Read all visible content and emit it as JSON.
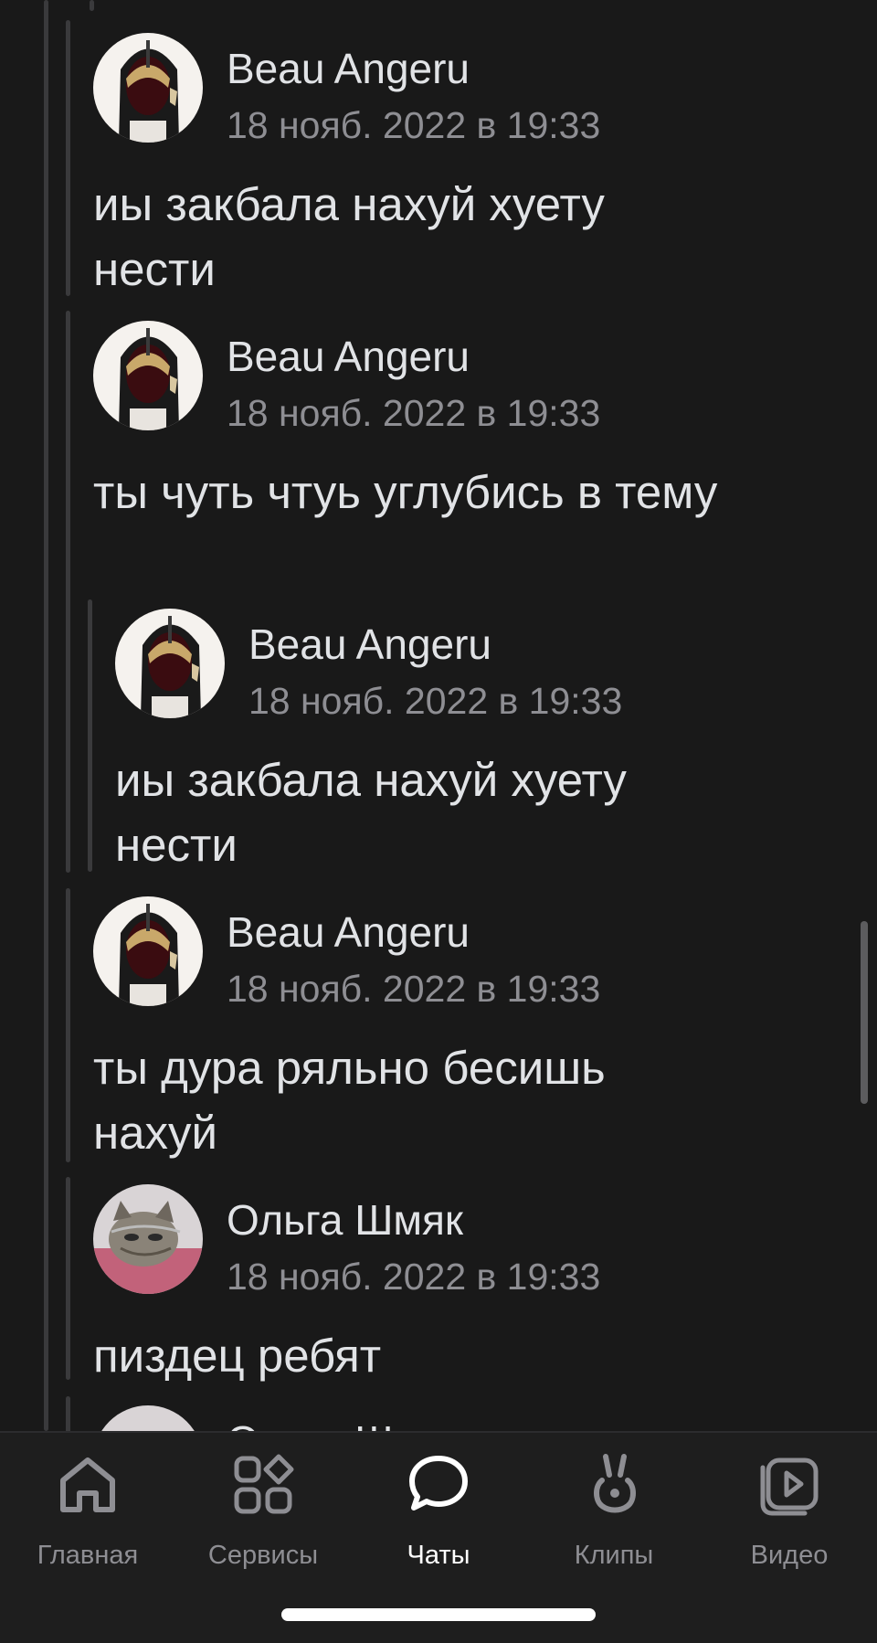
{
  "messages": [
    {
      "author": "Beau Angeru",
      "time": "18 нояб. 2022 в 19:33",
      "text": "иы закбала нахуй хуету нести",
      "avatar": "dark-figure-avatar"
    },
    {
      "author": "Beau Angeru",
      "time": "18 нояб. 2022 в 19:33",
      "text": "ты чуть чтуь углубись в тему",
      "avatar": "dark-figure-avatar"
    },
    {
      "author": "Beau Angeru",
      "time": "18 нояб. 2022 в 19:33",
      "text": "иы закбала нахуй хуету нести",
      "avatar": "dark-figure-avatar"
    },
    {
      "author": "Beau Angeru",
      "time": "18 нояб. 2022 в 19:33",
      "text": "ты дура ряльно бесишь нахуй",
      "avatar": "dark-figure-avatar"
    },
    {
      "author": "Ольга Шмяк",
      "time": "18 нояб. 2022 в 19:33",
      "text": "пиздец ребят",
      "avatar": "cat-avatar"
    },
    {
      "author": "Ольга Шмяк",
      "avatar": "cat-avatar"
    }
  ],
  "tabbar": {
    "tabs": [
      {
        "label": "Главная",
        "icon": "home-icon",
        "active": false
      },
      {
        "label": "Сервисы",
        "icon": "services-icon",
        "active": false
      },
      {
        "label": "Чаты",
        "icon": "chat-bubble-icon",
        "active": true
      },
      {
        "label": "Клипы",
        "icon": "clips-icon",
        "active": false
      },
      {
        "label": "Видео",
        "icon": "video-icon",
        "active": false
      }
    ]
  },
  "colors": {
    "background": "#191919",
    "text": "#e1e3e6",
    "secondary": "#8e8e93",
    "active_tab": "#ffffff",
    "thread_line": "#3a3a3c"
  }
}
